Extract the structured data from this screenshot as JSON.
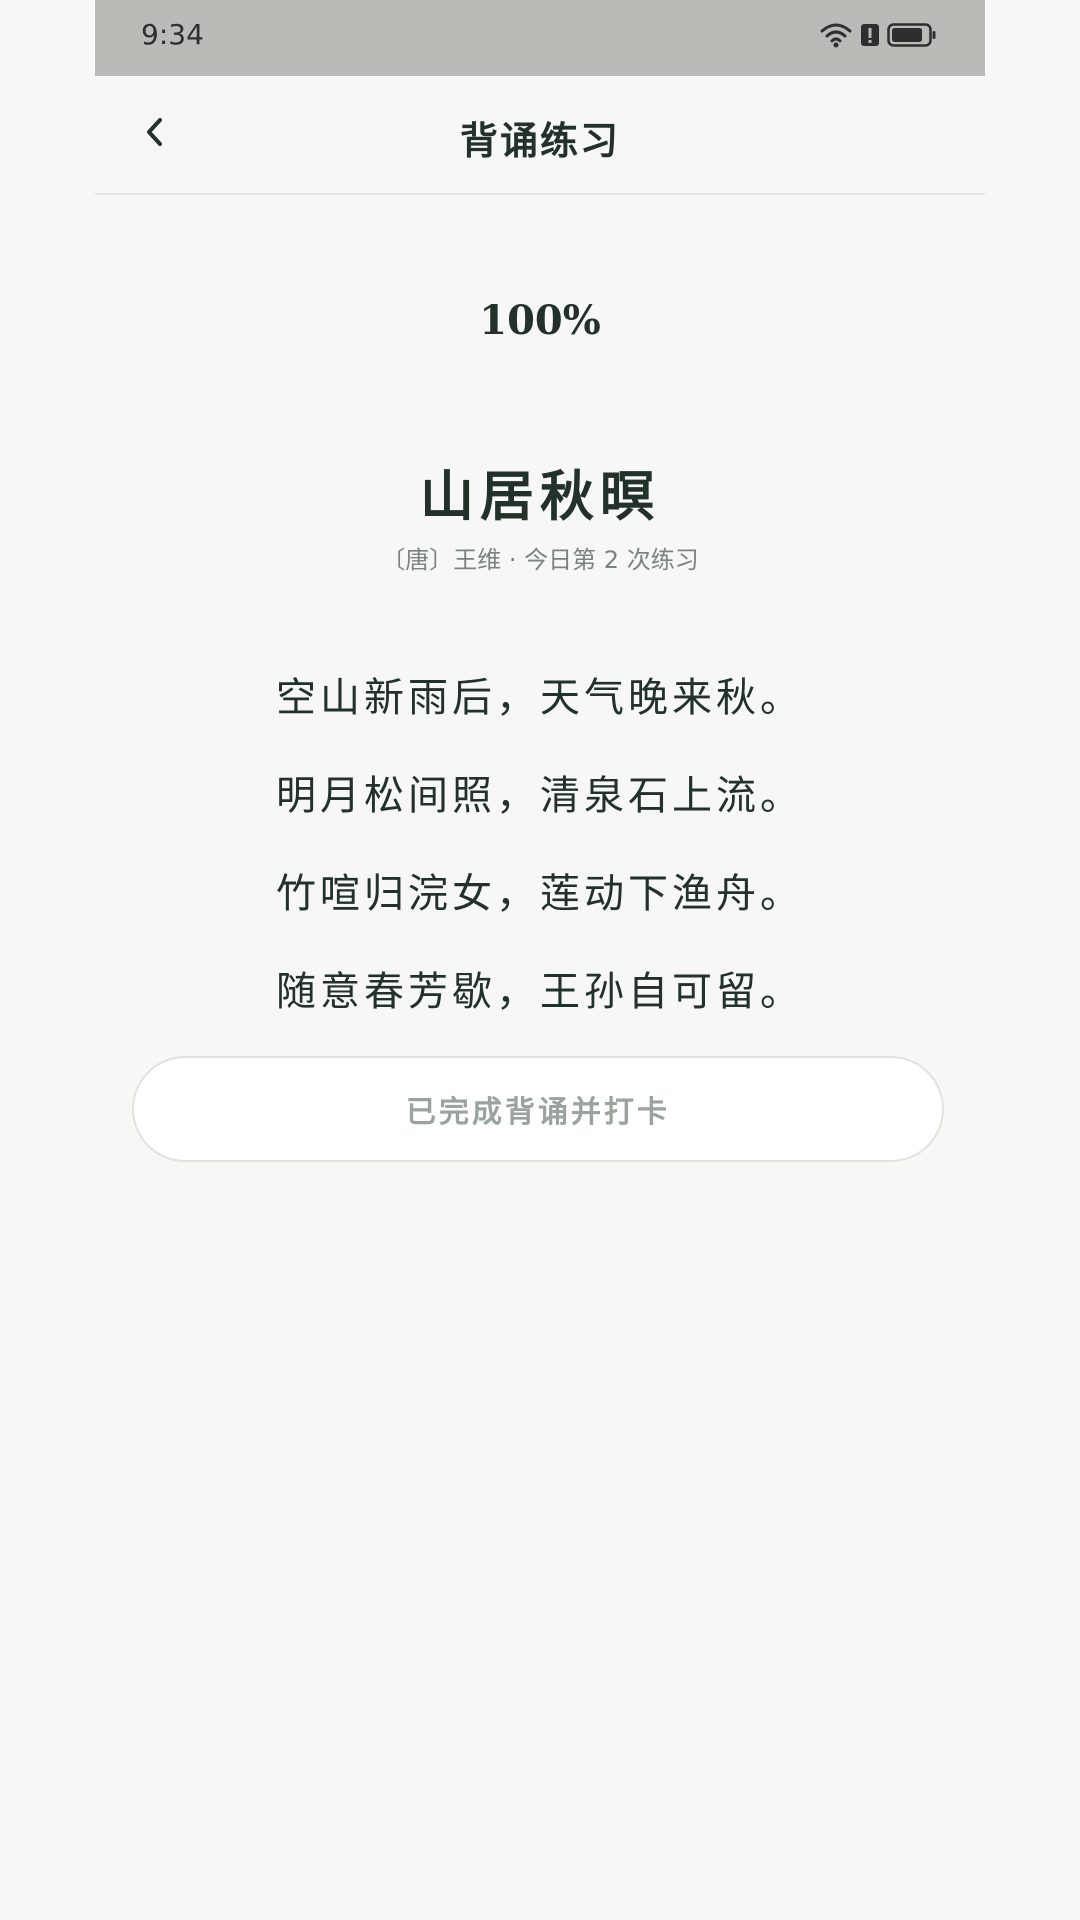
{
  "status_bar": {
    "time": "9:34",
    "icons": [
      "wifi-icon",
      "alert-icon",
      "battery-icon"
    ]
  },
  "header": {
    "title": "背诵练习",
    "back_icon": "chevron-left-icon"
  },
  "progress": {
    "label": "100%",
    "value": 1.0
  },
  "poem": {
    "title": "山居秋暝",
    "meta": "〔唐〕王维 · 今日第 2 次练习",
    "lines": [
      "空山新雨后，天气晚来秋。",
      "明月松间照，清泉石上流。",
      "竹喧归浣女，莲动下渔舟。",
      "随意春芳歇，王孙自可留。"
    ]
  },
  "actions": {
    "complete_label": "已完成背诵并打卡"
  },
  "colors": {
    "background": "#f7f8f6",
    "status_bar": "#babbb7",
    "text_primary": "#233228",
    "text_secondary": "#7b837d",
    "button_text": "#9aa39d"
  }
}
